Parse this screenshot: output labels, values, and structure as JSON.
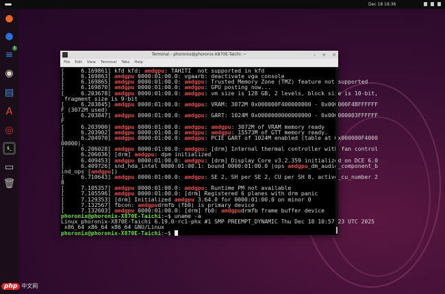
{
  "topbar": {
    "clock": "Dec 18 19:36"
  },
  "dock": {
    "items": [
      {
        "name": "firefox",
        "color": "#e8652b",
        "glyph": "●"
      },
      {
        "name": "thunderbird",
        "color": "#2a6fd6",
        "glyph": "●"
      },
      {
        "name": "notes",
        "color": "#3b7bd4",
        "glyph": "≡",
        "badge": "1"
      },
      {
        "name": "rhythmbox",
        "color": "#d8d8c8",
        "glyph": "◉"
      },
      {
        "name": "writer",
        "color": "#4a90d9",
        "glyph": "▤"
      },
      {
        "name": "app-center",
        "color": "#e0552a",
        "glyph": "A"
      },
      {
        "name": "help",
        "color": "#d93030",
        "glyph": "◎"
      },
      {
        "name": "terminal",
        "color": "#2b2b2b",
        "glyph": "$_"
      },
      {
        "name": "drive",
        "color": "#ccc",
        "glyph": "▭"
      },
      {
        "name": "trash",
        "color": "#bbb",
        "glyph": "🗑"
      }
    ]
  },
  "window": {
    "title": "Terminal - phoronix@phoronix-X870E-Taichi: ~",
    "menu": [
      "File",
      "Edit",
      "View",
      "Terminal",
      "Tabs",
      "Help"
    ],
    "lines": [
      [
        [
          "[     6.169861] kfd kfd: ",
          ""
        ],
        [
          "amdgpu",
          "r"
        ],
        [
          ": TAHITI  not supported in kfd",
          ""
        ]
      ],
      [
        [
          "[     6.169863] ",
          ""
        ],
        [
          "amdgpu",
          "r"
        ],
        [
          " 0000:01:00.0: vgaarb: deactivate vga console",
          ""
        ]
      ],
      [
        [
          "[     6.169865] ",
          ""
        ],
        [
          "amdgpu",
          "r"
        ],
        [
          " 0000:01:00.0: ",
          ""
        ],
        [
          "amdgpu",
          "r"
        ],
        [
          ": Trusted Memory Zone (TMZ) feature not supported",
          ""
        ]
      ],
      [
        [
          "[     6.169870] ",
          ""
        ],
        [
          "amdgpu",
          "r"
        ],
        [
          " 0000:01:00.0: ",
          ""
        ],
        [
          "amdgpu",
          "r"
        ],
        [
          ": GPU posting now...",
          ""
        ]
      ],
      [
        [
          "[     6.203678] ",
          ""
        ],
        [
          "amdgpu",
          "r"
        ],
        [
          " 0000:01:00.0: ",
          ""
        ],
        [
          "amdgpu",
          "r"
        ],
        [
          ": vm size is 128 GB, 2 levels, block size is 10-bit,",
          ""
        ]
      ],
      [
        [
          " fragment size is 9-bit",
          ""
        ]
      ],
      [
        [
          "[     6.203845] ",
          ""
        ],
        [
          "amdgpu",
          "r"
        ],
        [
          " 0000:01:00.0: ",
          ""
        ],
        [
          "amdgpu",
          "r"
        ],
        [
          ": VRAM: 3072M 0x000000F400000000 - 0x000000F4BFFFFFF",
          ""
        ]
      ],
      [
        [
          "F (3072M used)",
          ""
        ]
      ],
      [
        [
          "[     6.203847] ",
          ""
        ],
        [
          "amdgpu",
          "r"
        ],
        [
          " 0000:01:00.0: ",
          ""
        ],
        [
          "amdgpu",
          "r"
        ],
        [
          ": GART: 1024M 0x0000000000000000 - 0x000000003FFFFFF",
          ""
        ]
      ],
      [
        [
          "F",
          ""
        ]
      ],
      [
        [
          "[     6.203900] ",
          ""
        ],
        [
          "amdgpu",
          "r"
        ],
        [
          " 0000:01:00.0: ",
          ""
        ],
        [
          "amdgpu",
          "r"
        ],
        [
          ": ",
          ""
        ],
        [
          "amdgpu",
          "r"
        ],
        [
          ": 3072M of VRAM memory ready",
          ""
        ]
      ],
      [
        [
          "[     6.203902] ",
          ""
        ],
        [
          "amdgpu",
          "r"
        ],
        [
          " 0000:01:00.0: ",
          ""
        ],
        [
          "amdgpu",
          "r"
        ],
        [
          ": ",
          ""
        ],
        [
          "amdgpu",
          "r"
        ],
        [
          ": 15573M of GTT memory ready.",
          ""
        ]
      ],
      [
        [
          "[     6.204970] ",
          ""
        ],
        [
          "amdgpu",
          "r"
        ],
        [
          " 0000:01:00.0: ",
          ""
        ],
        [
          "amdgpu",
          "r"
        ],
        [
          ": PCIE GART of 1024M enabled (table at 0x000000F4000",
          ""
        ]
      ],
      [
        [
          "00000).",
          ""
        ]
      ],
      [
        [
          "[     6.206028] ",
          ""
        ],
        [
          "amdgpu",
          "r"
        ],
        [
          " 0000:01:00.0: ",
          ""
        ],
        [
          "amdgpu",
          "r"
        ],
        [
          ": [drm] Internal thermal controller with fan control",
          ""
        ]
      ],
      [
        [
          "[     6.206036] [drm] ",
          ""
        ],
        [
          "amdgpu",
          "r"
        ],
        [
          ": dpm initialized",
          ""
        ]
      ],
      [
        [
          "[     6.409453] ",
          ""
        ],
        [
          "amdgpu",
          "r"
        ],
        [
          " 0000:01:00.0: ",
          ""
        ],
        [
          "amdgpu",
          "r"
        ],
        [
          ": [drm] Display Core v3.2.359 initialized on DCE 6.0",
          ""
        ]
      ],
      [
        [
          "[     6.409726] snd_hda_intel 0000:01:00.1: bound 0000:01:00.0 (ops ",
          ""
        ],
        [
          "amdgpu",
          "r"
        ],
        [
          "_dm_audio_component_b",
          ""
        ]
      ],
      [
        [
          "ind_ops [",
          ""
        ],
        [
          "amdgpu",
          "r"
        ],
        [
          "])",
          ""
        ]
      ],
      [
        [
          "[     6.710643] ",
          ""
        ],
        [
          "amdgpu",
          "r"
        ],
        [
          " 0000:01:00.0: ",
          ""
        ],
        [
          "amdgpu",
          "r"
        ],
        [
          ": SE 2, SH per SE 2, CU per SH 8, active_cu_number 2",
          ""
        ]
      ],
      [
        [
          "8",
          ""
        ]
      ],
      [
        [
          "[     7.105357] ",
          ""
        ],
        [
          "amdgpu",
          "r"
        ],
        [
          " 0000:01:00.0: ",
          ""
        ],
        [
          "amdgpu",
          "r"
        ],
        [
          ": Runtime PM not available",
          ""
        ]
      ],
      [
        [
          "[     7.105596] ",
          ""
        ],
        [
          "amdgpu",
          "r"
        ],
        [
          " 0000:01:00.0: [drm] Registered 6 planes with drm panic",
          ""
        ]
      ],
      [
        [
          "[     7.129353] [drm] Initialized ",
          ""
        ],
        [
          "amdgpu",
          "r"
        ],
        [
          " 3.64.0 for 0000:01:00.0 on minor 0",
          ""
        ]
      ],
      [
        [
          "[     7.132567] fbcon: ",
          ""
        ],
        [
          "amdgpu",
          "r"
        ],
        [
          "drmfb (fb0) is primary device",
          ""
        ]
      ],
      [
        [
          "[     7.132603] ",
          ""
        ],
        [
          "amdgpu",
          "r"
        ],
        [
          " 0000:01:00.0: [drm] fb0: ",
          ""
        ],
        [
          "amdgpu",
          "r"
        ],
        [
          "drmfb frame buffer device",
          ""
        ]
      ],
      [
        [
          "phoronix@phoronix-X870E-Taichi",
          ""
        ],
        [
          ":~$ uname -a",
          ""
        ]
      ],
      [
        [
          "Linux phoronix-X870E-Taichi 6.19.0-rc1-phx #1 SMP PREEMPT_DYNAMIC Thu Dec 18 10:57:23 UTC 2025",
          ""
        ]
      ],
      [
        [
          " x86_64 x86_64 x86_64 GNU/Linux",
          ""
        ]
      ],
      [
        [
          "phoronix@phoronix-X870E-Taichi",
          ""
        ],
        [
          ":~$ ",
          ""
        ]
      ]
    ]
  },
  "watermark": {
    "logo": "php",
    "text": "中文网"
  },
  "colors": {
    "error": "#e05050",
    "prompt": "#7ae04a"
  }
}
